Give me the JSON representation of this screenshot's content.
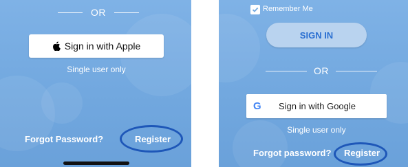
{
  "left_panel": {
    "or_label": "OR",
    "apple_button_label": "Sign in with Apple",
    "single_user_note": "Single user only",
    "forgot_password": "Forgot Password?",
    "register": "Register"
  },
  "right_panel": {
    "remember_me": "Remember Me",
    "sign_in": "SIGN IN",
    "or_label": "OR",
    "google_button_label": "Sign in with Google",
    "single_user_note": "Single user only",
    "forgot_password": "Forgot password?",
    "register": "Register"
  },
  "colors": {
    "background": "#72a8df",
    "highlight_ring": "#1e57b8",
    "sign_in_button": "#b9d3ef",
    "sign_in_text": "#2a6fd1"
  }
}
